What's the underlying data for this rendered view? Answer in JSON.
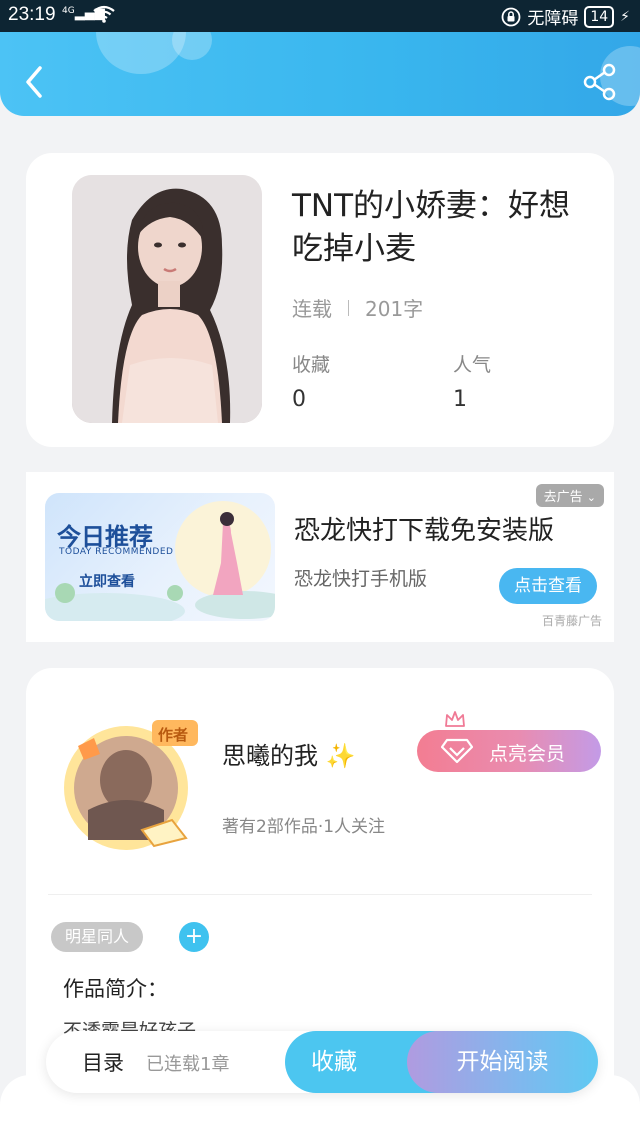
{
  "status_bar": {
    "time": "23:19",
    "network": "4G",
    "no_disturb": "无障碍",
    "battery": "14"
  },
  "colors": {
    "accent": "#39b6ee",
    "vip_start": "#f37d92",
    "vip_end": "#c39be7",
    "tag_bg": "#c8c8c8"
  },
  "book": {
    "title": "TNT的小娇妻：好想吃掉小麦",
    "status": "连载",
    "word_count": "201字",
    "favorites_label": "收藏",
    "favorites_value": "0",
    "popularity_label": "人气",
    "popularity_value": "1"
  },
  "ad": {
    "close_label": "去广告",
    "image_title": "今日推荐",
    "image_subtitle": "TODAY RECOMMENDED",
    "image_cta": "立即查看",
    "title": "恐龙快打下载免安装版",
    "subtitle": "恐龙快打手机版",
    "button": "点击查看",
    "source": "百青藤广告"
  },
  "author": {
    "badge": "作者",
    "name": "思曦的我",
    "info": "著有2部作品·1人关注",
    "vip_button": "点亮会员"
  },
  "tags": [
    "明星同人"
  ],
  "tag_add": "+",
  "intro": {
    "label": "作品简介：",
    "text": "不透露是好孩子"
  },
  "bottom": {
    "toc": "目录",
    "chapters": "已连载1章",
    "collect": "收藏",
    "read": "开始阅读"
  },
  "icons": [
    "back-icon",
    "share-icon",
    "diamond-icon",
    "crown-icon",
    "sparkle-icon",
    "wifi-icon",
    "signal-icon",
    "battery-icon"
  ]
}
